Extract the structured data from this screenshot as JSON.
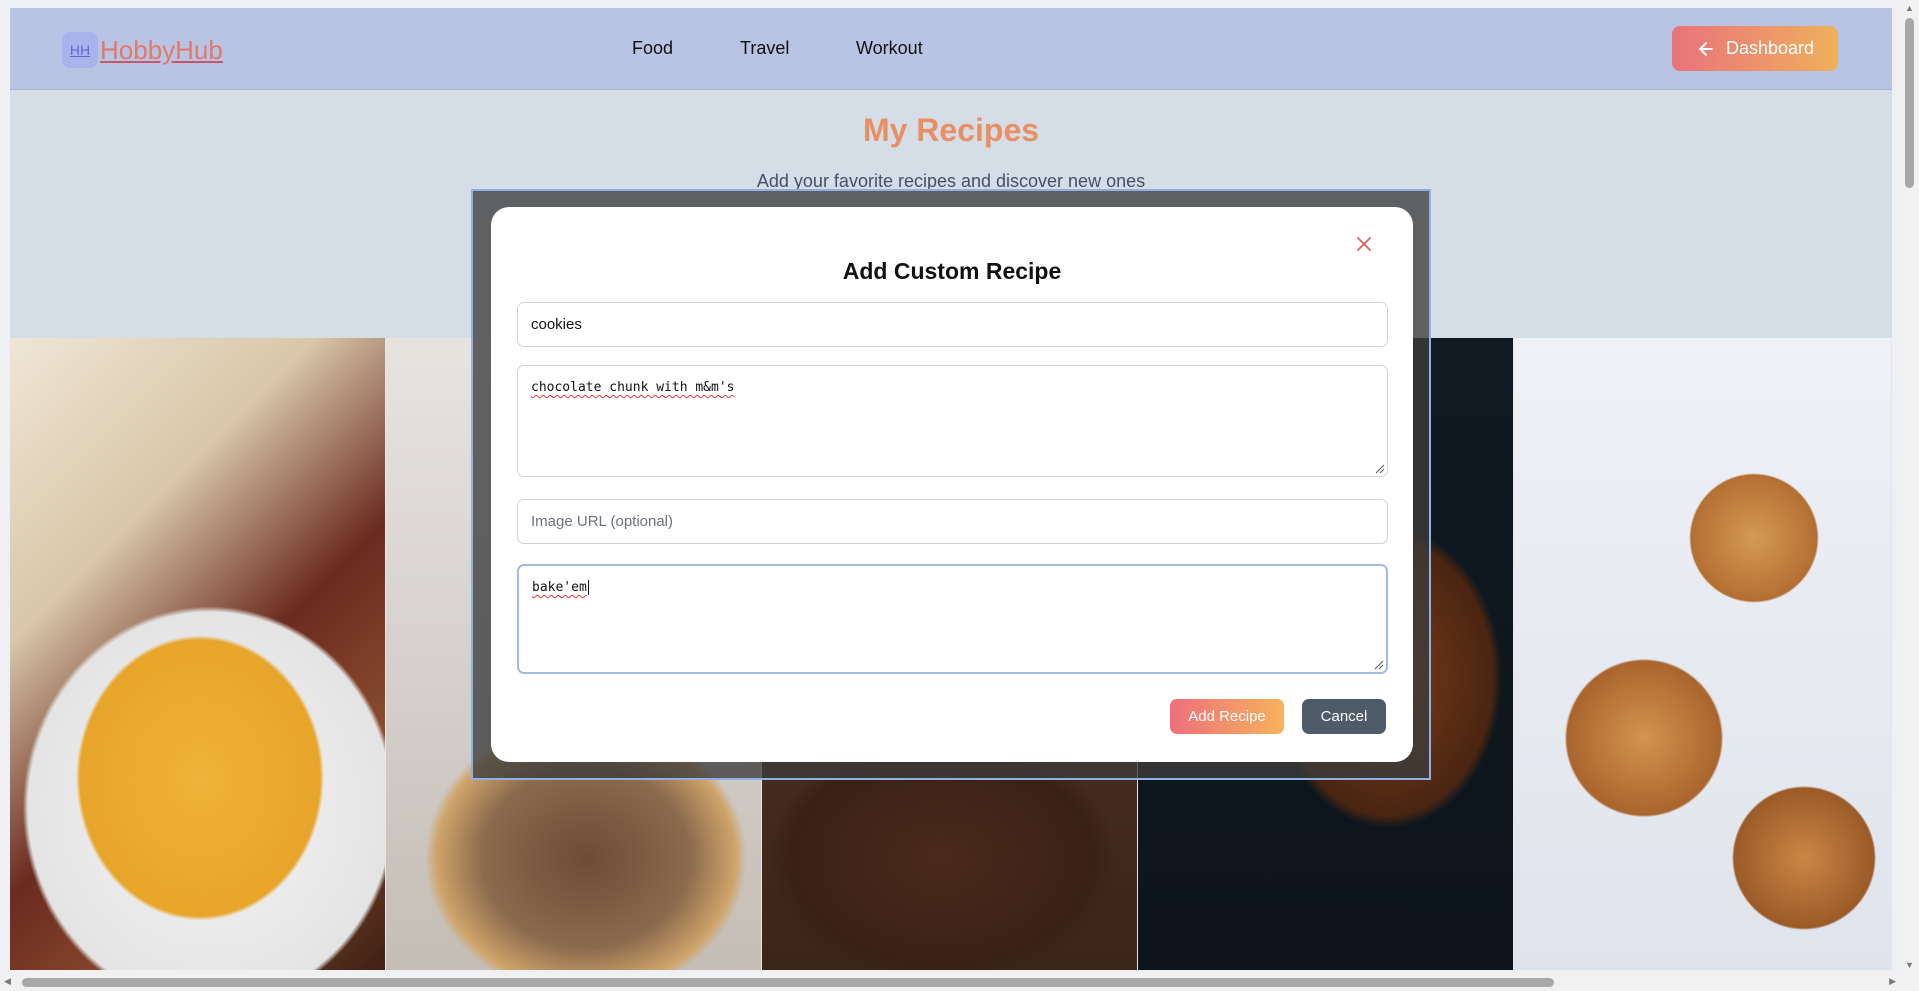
{
  "header": {
    "logo_badge": "HH",
    "logo_text": "HobbyHub",
    "nav": [
      "Food",
      "Travel",
      "Workout"
    ],
    "dashboard_label": "Dashboard"
  },
  "page": {
    "title": "My Recipes",
    "subtitle": "Add your favorite recipes and discover new ones"
  },
  "modal": {
    "title": "Add Custom Recipe",
    "name_value": "cookies",
    "description_value": "chocolate chunk with m&m's",
    "image_url_placeholder": "Image URL (optional)",
    "steps_value": "bake'em",
    "add_label": "Add Recipe",
    "cancel_label": "Cancel"
  },
  "icons": {
    "dashboard": "arrow-left-icon",
    "close": "close-icon"
  },
  "colors": {
    "accent": "#e98f63",
    "header_bg": "#b9c3e3",
    "cancel_bg": "#4f5b69"
  }
}
